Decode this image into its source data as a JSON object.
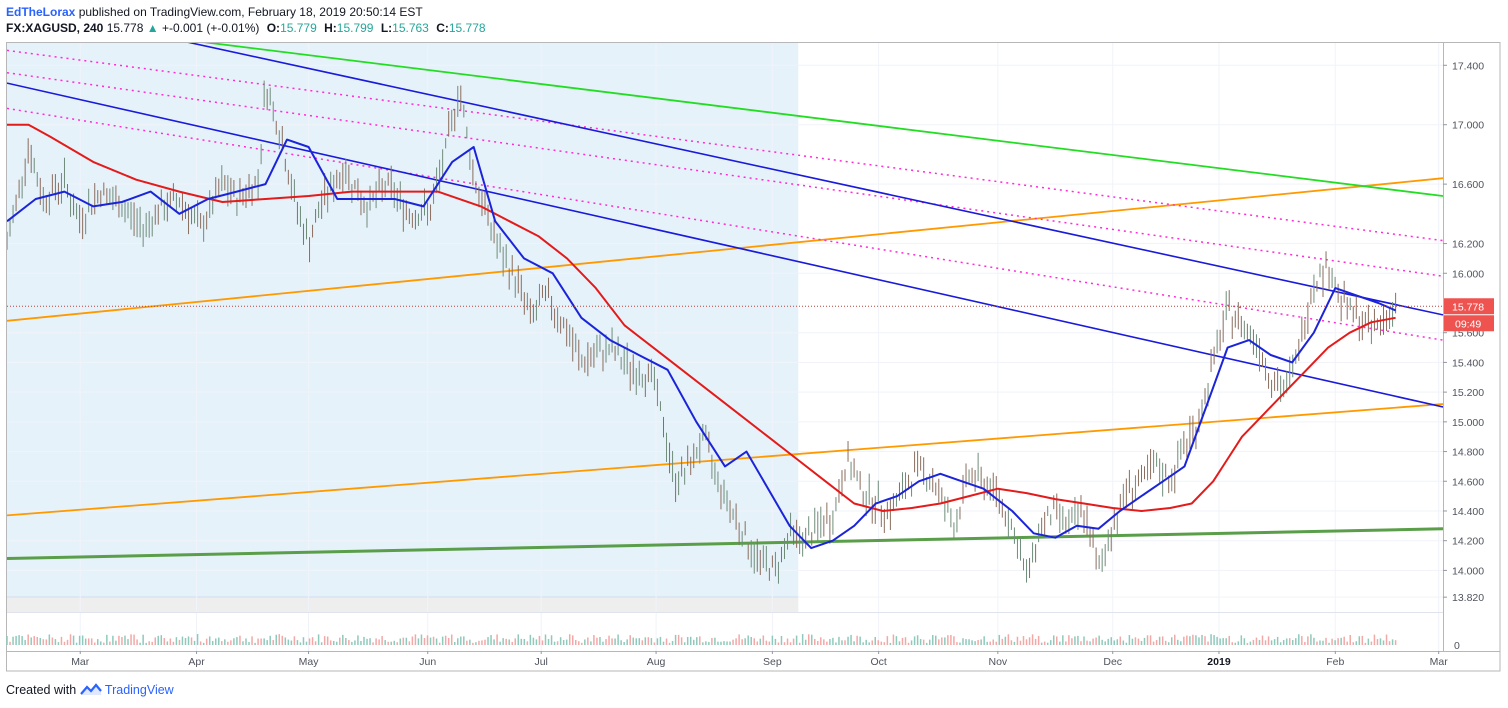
{
  "header": {
    "author": "EdTheLorax",
    "published": "published on TradingView.com, February 18, 2019 20:50:14 EST",
    "symbol": "FX:XAGUSD, 240",
    "last": "15.778",
    "change_arrow": "▲",
    "change": "+-0.001 (+-0.01%)",
    "open_label": "O:",
    "open": "15.779",
    "high_label": "H:",
    "high": "15.799",
    "low_label": "L:",
    "low": "15.763",
    "close_label": "C:",
    "close": "15.778"
  },
  "footer": {
    "created_with": "Created with",
    "brand": "TradingView",
    "logo_icon": "tradingview-logo-icon"
  },
  "colors": {
    "blue_channel": "#1a1adb",
    "magenta_dotted": "#ff2ad8",
    "green_line": "#22dd22",
    "orange_line": "#ff9900",
    "dark_green_support": "#5a9e4a",
    "ma_red": "#e31b1b",
    "ma_blue": "#1b24d9",
    "shaded": "#e6f2fa",
    "last_price_badge": "#ef5350",
    "candles": "#7e7466"
  },
  "chart_data": {
    "type": "line",
    "title": "",
    "xlabel": "",
    "ylabel": "",
    "y_axis_side": "right",
    "ylim": [
      13.72,
      17.55
    ],
    "xlim": [
      0,
      100
    ],
    "yticks": [
      "17.400",
      "17.000",
      "16.600",
      "16.200",
      "16.000",
      "15.600",
      "15.400",
      "15.200",
      "15.000",
      "14.800",
      "14.600",
      "14.400",
      "14.200",
      "14.000",
      "13.820"
    ],
    "volume_axis_label": "0",
    "xticks": [
      {
        "label": "Mar",
        "x": 5.1
      },
      {
        "label": "Apr",
        "x": 13.2
      },
      {
        "label": "May",
        "x": 21.0
      },
      {
        "label": "Jun",
        "x": 29.3
      },
      {
        "label": "Jul",
        "x": 37.2
      },
      {
        "label": "Aug",
        "x": 45.2
      },
      {
        "label": "Sep",
        "x": 53.3
      },
      {
        "label": "Oct",
        "x": 60.7
      },
      {
        "label": "Nov",
        "x": 69.0
      },
      {
        "label": "Dec",
        "x": 77.0
      },
      {
        "label": "2019",
        "x": 84.4,
        "bold": true
      },
      {
        "label": "Feb",
        "x": 92.5
      },
      {
        "label": "Mar",
        "x": 99.7
      }
    ],
    "last_price": {
      "value": 15.778,
      "label": "15.778",
      "countdown": "09:49"
    },
    "shaded_region": {
      "x0": 0,
      "x1": 55.1,
      "floor": 13.82
    },
    "series": [
      {
        "style": "ohlc-candles",
        "x": [
          0,
          1.5,
          2.5,
          4,
          5,
          6.5,
          8,
          9.5,
          10.5,
          12,
          13.5,
          15,
          16,
          17.5,
          18,
          19,
          20,
          21,
          22,
          23.5,
          25,
          26.5,
          28,
          29.5,
          30.5,
          31.5,
          32.5,
          33,
          34.5,
          35.5,
          36.5,
          37.5,
          38.5,
          40,
          41,
          42,
          43.5,
          45,
          46.5,
          47.5,
          48.5,
          49.5,
          51,
          52,
          53.5,
          54.5,
          55.5,
          56.5,
          57.5,
          58.5,
          59.5,
          60.5,
          61.5,
          62.5,
          63.5,
          64.5,
          66,
          67,
          68,
          69,
          70,
          71,
          72,
          73,
          74,
          75,
          76,
          77,
          78,
          79,
          80,
          81,
          82,
          83,
          84,
          85,
          86,
          87,
          88,
          89,
          90,
          91,
          92,
          93,
          94,
          95,
          96,
          96.7
        ],
        "values": [
          16.2,
          16.85,
          16.5,
          16.62,
          16.35,
          16.55,
          16.45,
          16.3,
          16.42,
          16.5,
          16.3,
          16.6,
          16.5,
          16.62,
          17.28,
          16.95,
          16.5,
          16.2,
          16.5,
          16.7,
          16.45,
          16.6,
          16.4,
          16.42,
          16.8,
          17.25,
          16.65,
          16.5,
          16.1,
          15.95,
          15.7,
          15.85,
          15.7,
          15.4,
          15.45,
          15.5,
          15.35,
          15.3,
          14.6,
          14.7,
          14.9,
          14.6,
          14.3,
          14.1,
          14.0,
          14.25,
          14.2,
          14.3,
          14.35,
          14.75,
          14.55,
          14.45,
          14.4,
          14.55,
          14.7,
          14.6,
          14.3,
          14.65,
          14.6,
          14.5,
          14.3,
          13.95,
          14.3,
          14.4,
          14.3,
          14.4,
          14.0,
          14.3,
          14.55,
          14.6,
          14.7,
          14.6,
          14.85,
          15.0,
          15.4,
          15.75,
          15.65,
          15.55,
          15.3,
          15.2,
          15.5,
          15.95,
          16.05,
          15.8,
          15.7,
          15.62,
          15.7,
          15.78
        ]
      },
      {
        "style": "ma-red",
        "x": [
          0,
          1.5,
          3,
          6,
          9,
          12,
          15,
          18,
          21,
          24,
          27,
          30,
          33,
          35,
          37,
          39,
          41,
          43,
          45,
          47,
          49,
          51,
          53,
          55,
          57,
          59,
          61,
          63,
          65,
          67,
          69,
          71,
          73,
          75,
          77,
          79,
          81,
          82.5,
          84,
          85,
          86,
          87.5,
          89,
          90.5,
          92,
          93.5,
          95,
          96.7
        ],
        "values": [
          17.0,
          17.0,
          16.92,
          16.75,
          16.63,
          16.55,
          16.48,
          16.5,
          16.52,
          16.55,
          16.55,
          16.55,
          16.45,
          16.35,
          16.25,
          16.1,
          15.9,
          15.65,
          15.5,
          15.35,
          15.2,
          15.05,
          14.9,
          14.75,
          14.6,
          14.45,
          14.4,
          14.42,
          14.45,
          14.5,
          14.55,
          14.52,
          14.48,
          14.45,
          14.42,
          14.4,
          14.42,
          14.45,
          14.6,
          14.75,
          14.9,
          15.05,
          15.2,
          15.35,
          15.5,
          15.6,
          15.67,
          15.7
        ]
      },
      {
        "style": "ma-blue",
        "x": [
          0,
          2,
          4,
          6,
          8,
          10,
          12,
          14,
          16,
          18,
          19.5,
          21,
          23,
          25,
          27,
          29,
          31,
          32.5,
          34,
          36,
          38,
          40,
          42,
          44,
          46,
          48,
          50,
          51.5,
          53,
          54.5,
          56,
          57.5,
          59,
          60.5,
          62,
          63.5,
          65,
          66.5,
          68,
          70,
          71.5,
          73,
          74.5,
          76,
          77.5,
          79,
          80.5,
          82,
          83.5,
          85,
          86.5,
          88,
          89.5,
          91,
          92.5,
          94,
          95.5,
          96.7
        ],
        "values": [
          16.35,
          16.5,
          16.55,
          16.45,
          16.48,
          16.55,
          16.4,
          16.5,
          16.55,
          16.6,
          16.9,
          16.85,
          16.5,
          16.5,
          16.5,
          16.45,
          16.75,
          16.85,
          16.35,
          16.1,
          16.0,
          15.7,
          15.55,
          15.45,
          15.35,
          15.0,
          14.7,
          14.8,
          14.55,
          14.3,
          14.15,
          14.2,
          14.3,
          14.45,
          14.5,
          14.6,
          14.65,
          14.6,
          14.55,
          14.4,
          14.25,
          14.22,
          14.3,
          14.28,
          14.4,
          14.5,
          14.6,
          14.7,
          15.1,
          15.5,
          15.55,
          15.45,
          15.4,
          15.6,
          15.9,
          15.85,
          15.8,
          15.75
        ]
      },
      {
        "style": "channel-blue",
        "x": [
          0,
          100
        ],
        "values": [
          17.28,
          15.1
        ]
      },
      {
        "style": "channel-blue",
        "x": [
          0,
          100
        ],
        "values": [
          17.82,
          15.72
        ]
      },
      {
        "style": "dotted-magenta",
        "x": [
          0,
          100
        ],
        "values": [
          17.5,
          16.22
        ]
      },
      {
        "style": "dotted-magenta",
        "x": [
          0,
          100
        ],
        "values": [
          17.35,
          15.98
        ]
      },
      {
        "style": "dotted-magenta",
        "x": [
          0,
          100
        ],
        "values": [
          17.11,
          15.55
        ]
      },
      {
        "style": "line-green",
        "x": [
          0,
          100
        ],
        "values": [
          17.72,
          16.52
        ]
      },
      {
        "style": "line-orange",
        "x": [
          0,
          100
        ],
        "values": [
          15.68,
          16.64
        ]
      },
      {
        "style": "line-orange",
        "x": [
          0,
          100
        ],
        "values": [
          14.37,
          15.12
        ]
      },
      {
        "style": "support-green",
        "x": [
          0,
          100
        ],
        "values": [
          14.08,
          14.28
        ]
      }
    ]
  }
}
